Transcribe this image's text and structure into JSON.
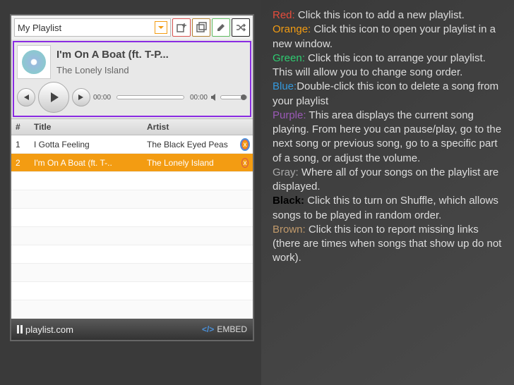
{
  "player": {
    "dropdown_label": "My Playlist",
    "nowplaying": {
      "title": "I'm On A Boat (ft. T-P...",
      "artist": "The Lonely Island",
      "time_current": "00:00",
      "time_total": "00:00"
    },
    "columns": {
      "num": "#",
      "title": "Title",
      "artist": "Artist"
    },
    "rows": [
      {
        "n": "1",
        "title": "I Gotta Feeling",
        "artist": "The Black Eyed Peas",
        "selected": false,
        "del_highlight": true
      },
      {
        "n": "2",
        "title": "I'm On A Boat (ft. T-..",
        "artist": "The Lonely Island",
        "selected": true,
        "del_highlight": false
      }
    ],
    "footer_site": "playlist.com",
    "footer_embed": "EMBED",
    "footer_code": "</>"
  },
  "legend": [
    {
      "label": "Red:",
      "cls": "lbl-red",
      "text": " Click this icon to add a new playlist."
    },
    {
      "label": "Orange:",
      "cls": "lbl-orange",
      "text": " Click this icon to open your playlist in a new window."
    },
    {
      "label": "Green:",
      "cls": "lbl-green",
      "text": " Click this icon to arrange your playlist. This will allow you to change song order."
    },
    {
      "label": "Blue:",
      "cls": "lbl-blue",
      "text": "Double-click this icon to delete a song from your playlist"
    },
    {
      "label": "Purple:",
      "cls": "lbl-purple",
      "text": " This area displays the current song playing. From here you can pause/play, go to the next song or previous song, go to a specific part of a song, or adjust the volume."
    },
    {
      "label": "Gray:",
      "cls": "lbl-gray",
      "text": " Where all of your songs on the playlist are displayed."
    },
    {
      "label": "Black:",
      "cls": "lbl-black",
      "text": " Click this to turn on Shuffle, which allows songs to be played in random order."
    },
    {
      "label": "Brown:",
      "cls": "lbl-brown",
      "text": " Click this icon to report missing links (there are times when songs that show up do not work)."
    }
  ]
}
